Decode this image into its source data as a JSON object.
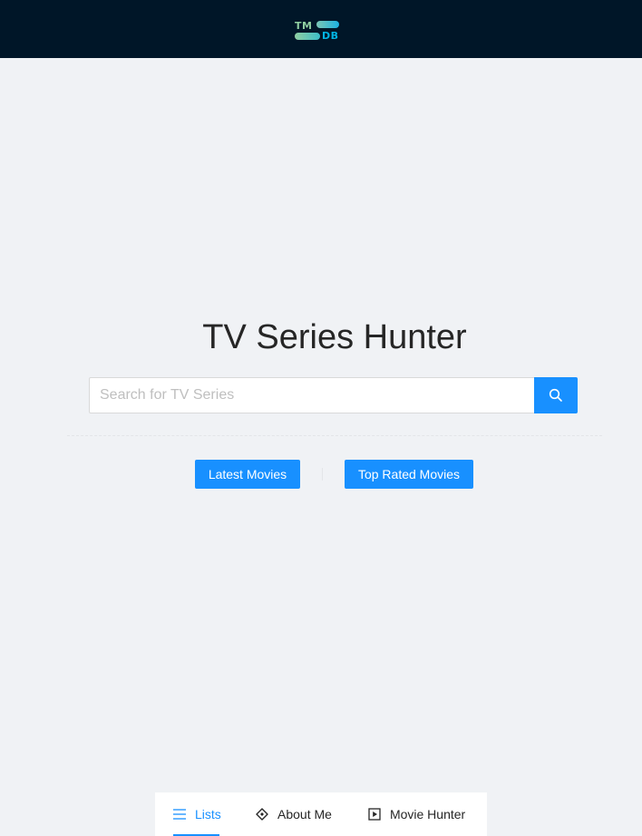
{
  "header": {
    "logo": {
      "top": "TM",
      "bottom": "DB"
    }
  },
  "main": {
    "title": "TV Series Hunter",
    "search": {
      "placeholder": "Search for TV Series",
      "value": ""
    },
    "buttons": {
      "latest": "Latest Movies",
      "top_rated": "Top Rated Movies"
    }
  },
  "bottom_nav": {
    "items": [
      {
        "label": "Lists",
        "icon": "menu-icon",
        "active": true
      },
      {
        "label": "About Me",
        "icon": "diamond-icon",
        "active": false
      },
      {
        "label": "Movie Hunter",
        "icon": "play-square-icon",
        "active": false
      }
    ]
  },
  "colors": {
    "header_bg": "#001628",
    "page_bg": "#f0f2f5",
    "primary": "#1890ff",
    "logo_green": "#90cea1",
    "logo_blue": "#01b4e4"
  }
}
